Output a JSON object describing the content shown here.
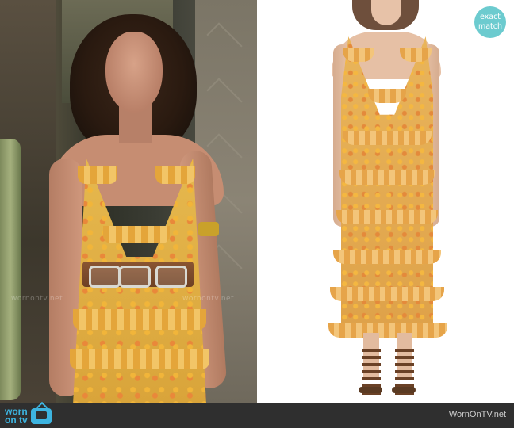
{
  "badge": {
    "line1": "exact",
    "line2": "match",
    "color": "#6ccbcf"
  },
  "watermarks": [
    "wornontv.net",
    "wornontv.net"
  ],
  "footer": {
    "logo_line1": "worn",
    "logo_line2": "on tv",
    "site": "WornOnTV.net",
    "logo_color": "#3db4e0",
    "bar_color": "#2f2f2f"
  },
  "icons": {
    "tv": "tv-icon"
  }
}
